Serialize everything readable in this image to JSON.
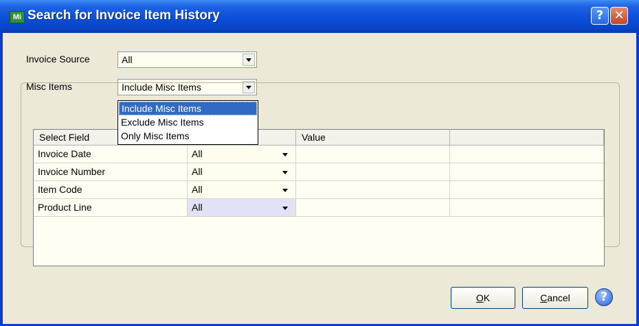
{
  "window": {
    "title": "Search for Invoice Item History",
    "app_icon_text": "Mi",
    "help_glyph": "?",
    "close_glyph": "✕"
  },
  "filters": {
    "invoice_source": {
      "label": "Invoice Source",
      "value": "All"
    },
    "misc_items": {
      "label": "Misc Items",
      "value": "Include Misc Items",
      "options": [
        "Include Misc Items",
        "Exclude Misc Items",
        "Only Misc Items"
      ],
      "highlighted": 0
    }
  },
  "grid": {
    "columns": [
      "Select Field",
      "",
      "Value"
    ],
    "rows": [
      {
        "field": "Invoice Date",
        "operator": "All"
      },
      {
        "field": "Invoice Number",
        "operator": "All"
      },
      {
        "field": "Item Code",
        "operator": "All"
      },
      {
        "field": "Product Line",
        "operator": "All"
      }
    ],
    "selected_row": 3
  },
  "buttons": {
    "ok_mnemonic": "O",
    "ok_rest": "K",
    "cancel_mnemonic": "C",
    "cancel_rest": "ancel",
    "help_glyph": "?"
  },
  "colors": {
    "titlebar": "#0a4fd8",
    "dialog_bg": "#ece9d8",
    "field_bg": "#fffdef",
    "highlight": "#316ac5",
    "selected_cell": "#e2e2f6"
  }
}
